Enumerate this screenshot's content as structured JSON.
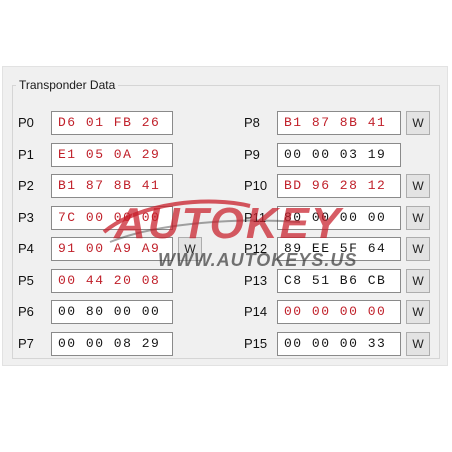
{
  "group_title": "Transponder Data",
  "colors": {
    "value_red": "#c0202a",
    "value_black": "#151515",
    "watermark_red": "#c81e2a",
    "watermark_grey": "#3a3a3a"
  },
  "pages": [
    {
      "label": "P0",
      "value": "D6 01 FB 26",
      "color": "red",
      "write": false
    },
    {
      "label": "P1",
      "value": "E1 05 0A 29",
      "color": "red",
      "write": false
    },
    {
      "label": "P2",
      "value": "B1 87 8B 41",
      "color": "red",
      "write": false
    },
    {
      "label": "P3",
      "value": "7C 00 00 00",
      "color": "red",
      "write": false
    },
    {
      "label": "P4",
      "value": "91 00 A9 A9",
      "color": "red",
      "write": true
    },
    {
      "label": "P5",
      "value": "00 44 20 08",
      "color": "red",
      "write": false
    },
    {
      "label": "P6",
      "value": "00 80 00 00",
      "color": "black",
      "write": false
    },
    {
      "label": "P7",
      "value": "00 00 08 29",
      "color": "black",
      "write": false
    },
    {
      "label": "P8",
      "value": "B1 87 8B 41",
      "color": "red",
      "write": true
    },
    {
      "label": "P9",
      "value": "00 00 03 19",
      "color": "black",
      "write": false
    },
    {
      "label": "P10",
      "value": "BD 96 28 12",
      "color": "red",
      "write": true
    },
    {
      "label": "P11",
      "value": "80 00 00 00",
      "color": "black",
      "write": true
    },
    {
      "label": "P12",
      "value": "89 EE 5F 64",
      "color": "black",
      "write": true
    },
    {
      "label": "P13",
      "value": "C8 51 B6 CB",
      "color": "black",
      "write": true
    },
    {
      "label": "P14",
      "value": "00 00 00 00",
      "color": "red",
      "write": true
    },
    {
      "label": "P15",
      "value": "00 00 00 33",
      "color": "black",
      "write": true
    }
  ],
  "write_button_label": "W",
  "watermark": {
    "brand": "AUTOKEY",
    "url": "WWW.AUTOKEYS.US"
  }
}
